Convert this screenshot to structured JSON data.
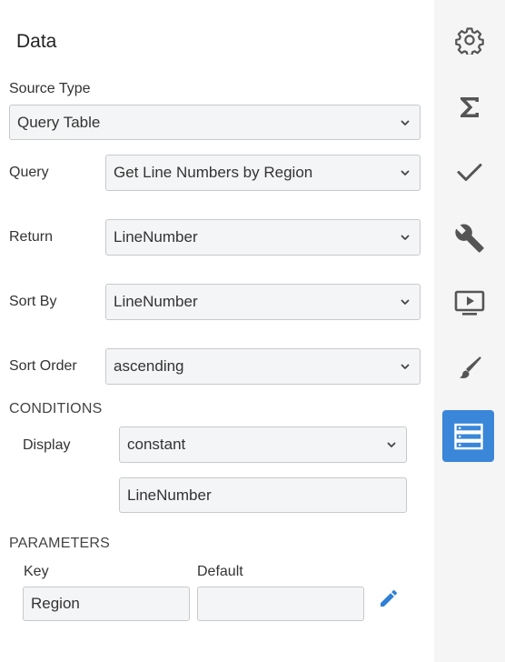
{
  "panel": {
    "title": "Data"
  },
  "source_type": {
    "label": "Source Type",
    "value": "Query Table"
  },
  "query": {
    "label": "Query",
    "value": "Get Line Numbers by Region"
  },
  "return": {
    "label": "Return",
    "value": "LineNumber"
  },
  "sort_by": {
    "label": "Sort By",
    "value": "LineNumber"
  },
  "sort_order": {
    "label": "Sort Order",
    "value": "ascending"
  },
  "conditions": {
    "heading": "CONDITIONS",
    "display_label": "Display",
    "display_value": "constant",
    "constant_value": "LineNumber"
  },
  "parameters": {
    "heading": "PARAMETERS",
    "key_header": "Key",
    "default_header": "Default",
    "rows": [
      {
        "key": "Region",
        "default": ""
      }
    ]
  },
  "sidebar": {
    "items": [
      {
        "name": "settings",
        "icon": "gear-icon"
      },
      {
        "name": "aggregate",
        "icon": "sigma-icon"
      },
      {
        "name": "validation",
        "icon": "checkmark-icon"
      },
      {
        "name": "tools",
        "icon": "wrench-icon"
      },
      {
        "name": "media",
        "icon": "play-screen-icon"
      },
      {
        "name": "style",
        "icon": "brush-icon"
      },
      {
        "name": "data",
        "icon": "database-icon",
        "active": true
      }
    ]
  },
  "colors": {
    "accent": "#3a86d9",
    "icon_gray": "#555555",
    "field_bg": "#f4f5f7",
    "rail_bg": "#f5f5f5"
  }
}
